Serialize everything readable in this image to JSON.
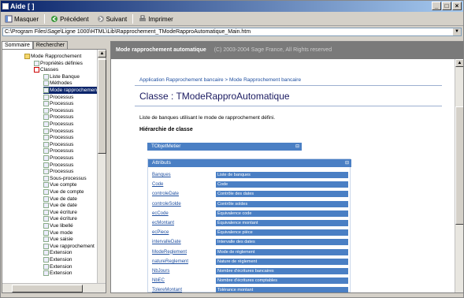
{
  "window": {
    "title": "Aide [ ]",
    "buttons": [
      "_",
      "□",
      "×"
    ]
  },
  "toolbar": {
    "items": [
      {
        "label": "Masquer",
        "icon": "hide-icon"
      },
      {
        "label": "Précédent",
        "icon": "back-icon"
      },
      {
        "label": "Suivant",
        "icon": "forward-icon"
      },
      {
        "label": "Imprimer",
        "icon": "print-icon"
      }
    ]
  },
  "address": {
    "value": "C:\\Program Files\\Sage\\Ligne 1000\\HTML\\Lib\\Rapprochement_TModeRapproAutomatique_Main.htm"
  },
  "tabs": {
    "contents": "Sommaire",
    "index": "Rechercher"
  },
  "tree": {
    "items": [
      {
        "label": "Mode Rapprochement",
        "indent": 2,
        "icon": "folder"
      },
      {
        "label": "Propriétés définies",
        "indent": 3,
        "icon": "page"
      },
      {
        "label": "Classes",
        "indent": 3,
        "icon": "red"
      },
      {
        "label": "Liste Banque",
        "indent": 4,
        "icon": "page"
      },
      {
        "label": "Méthodes",
        "indent": 4,
        "icon": "page"
      },
      {
        "label": "Mode rapprochement",
        "indent": 4,
        "icon": "page",
        "selected": true
      },
      {
        "label": "Processus",
        "indent": 4,
        "icon": "page"
      },
      {
        "label": "Processus",
        "indent": 4,
        "icon": "page"
      },
      {
        "label": "Processus",
        "indent": 4,
        "icon": "page"
      },
      {
        "label": "Processus",
        "indent": 4,
        "icon": "page"
      },
      {
        "label": "Processus",
        "indent": 4,
        "icon": "page"
      },
      {
        "label": "Processus",
        "indent": 4,
        "icon": "page"
      },
      {
        "label": "Processus",
        "indent": 4,
        "icon": "page"
      },
      {
        "label": "Processus",
        "indent": 4,
        "icon": "page"
      },
      {
        "label": "Processus",
        "indent": 4,
        "icon": "page"
      },
      {
        "label": "Processus",
        "indent": 4,
        "icon": "page"
      },
      {
        "label": "Processus",
        "indent": 4,
        "icon": "page"
      },
      {
        "label": "Processus",
        "indent": 4,
        "icon": "page"
      },
      {
        "label": "Sous-processus",
        "indent": 4,
        "icon": "page"
      },
      {
        "label": "Vue compte",
        "indent": 4,
        "icon": "page"
      },
      {
        "label": "Vue de compte",
        "indent": 4,
        "icon": "page"
      },
      {
        "label": "Vue de date",
        "indent": 4,
        "icon": "page"
      },
      {
        "label": "Vue de date",
        "indent": 4,
        "icon": "page"
      },
      {
        "label": "Vue écriture",
        "indent": 4,
        "icon": "page"
      },
      {
        "label": "Vue écriture",
        "indent": 4,
        "icon": "page"
      },
      {
        "label": "Vue libellé",
        "indent": 4,
        "icon": "page"
      },
      {
        "label": "Vue mode",
        "indent": 4,
        "icon": "page"
      },
      {
        "label": "Vue saisie",
        "indent": 4,
        "icon": "page"
      },
      {
        "label": "Vue rapprochement",
        "indent": 4,
        "icon": "page"
      },
      {
        "label": "Extension",
        "indent": 4,
        "icon": "page"
      },
      {
        "label": "Extension",
        "indent": 4,
        "icon": "page"
      },
      {
        "label": "Extension",
        "indent": 4,
        "icon": "page"
      },
      {
        "label": "Extension",
        "indent": 4,
        "icon": "page"
      }
    ]
  },
  "content": {
    "header_title": "Mode rapprochement automatique",
    "header_copy": "(C) 2003-2004 Sage France, All Rights reserved",
    "breadcrumb": "Application Rapprochement bancaire > Mode Rapprochement bancaire",
    "title": "Classe : TModeRapproAutomatique",
    "description": "Liste de banques utilisant le mode de rapprochement défini.",
    "hierarchy_label": "Hiérarchie de classe",
    "hierarchy_bar": "TObjetMetier",
    "attributes_bar": "Attributs",
    "attributes": [
      {
        "name": "Banques",
        "value": "Liste de banques"
      },
      {
        "name": "Code",
        "value": "Code"
      },
      {
        "name": "controleDate",
        "value": "Contrôle des dates"
      },
      {
        "name": "controleSolde",
        "value": "Contrôle soldes"
      },
      {
        "name": "ecCode",
        "value": "Équivalence code"
      },
      {
        "name": "ecMontant",
        "value": "Équivalence montant"
      },
      {
        "name": "ecPiece",
        "value": "Équivalence pièce"
      },
      {
        "name": "intervalleDate",
        "value": "Intervalle des dates"
      },
      {
        "name": "ModeReglement",
        "value": "Mode de règlement"
      },
      {
        "name": "natureReglement",
        "value": "Nature de règlement"
      },
      {
        "name": "NbJours",
        "value": "Nombre d'écritures bancaires"
      },
      {
        "name": "NbEC",
        "value": "Nombre d'écritures comptables"
      },
      {
        "name": "TolereMontant",
        "value": "Tolérance montant"
      }
    ]
  }
}
